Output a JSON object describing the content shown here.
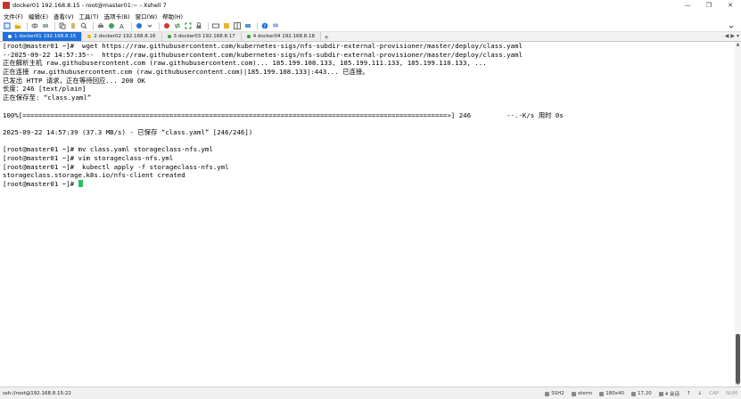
{
  "window": {
    "title": "docker01 192.168.8.15 - root@master01:~ - Xshell 7",
    "minimize_glyph": "—",
    "maximize_glyph": "❐",
    "close_glyph": "✕"
  },
  "menu": [
    "文件(F)",
    "编辑(E)",
    "查看(V)",
    "工具(T)",
    "选项卡(B)",
    "窗口(W)",
    "帮助(H)"
  ],
  "tabs": [
    {
      "label": "1 docker01 192.168.8.15",
      "active": true,
      "color": "#1e6fd9"
    },
    {
      "label": "2 docker02 192.168.8.16",
      "active": false,
      "color": "#f2b600"
    },
    {
      "label": "3 docker03 192.168.8.17",
      "active": false,
      "color": "#2ca02c"
    },
    {
      "label": "4 docker04 192.168.8.18",
      "active": false,
      "color": "#2ca02c"
    }
  ],
  "tab_add": "+",
  "tab_nav": {
    "prev": "◀",
    "next": "▶",
    "list": "▾"
  },
  "terminal_lines": [
    "[root@master01 ~]#  wget https://raw.githubusercontent.com/kubernetes-sigs/nfs-subdir-external-provisioner/master/deploy/class.yaml",
    "--2025-09-22 14:57:35--  https://raw.githubusercontent.com/kubernetes-sigs/nfs-subdir-external-provisioner/master/deploy/class.yaml",
    "正在解析主机 raw.githubusercontent.com (raw.githubusercontent.com)... 185.199.108.133, 185.199.111.133, 185.199.110.133, ...",
    "正在连接 raw.githubusercontent.com (raw.githubusercontent.com)|185.199.108.133|:443... 已连接。",
    "已发出 HTTP 请求，正在等待回应... 200 OK",
    "长度：246 [text/plain]",
    "正在保存至: “class.yaml”",
    "",
    "100%[===========================================================================================================>] 246         --.-K/s 用时 0s",
    "",
    "2025-09-22 14:57:39 (37.3 MB/s) - 已保存 “class.yaml” [246/246])",
    "",
    "[root@master01 ~]# mv class.yaml storageclass-nfs.yml",
    "[root@master01 ~]# vim storageclass-nfs.yml",
    "[root@master01 ~]#  kubectl apply -f storageclass-nfs.yml",
    "storageclass.storage.k8s.io/nfs-client created"
  ],
  "prompt": "[root@master01 ~]# ",
  "status": {
    "connection": "ssh://root@192.168.8.15:22",
    "protocol": "SSH2",
    "terminal": "xterm",
    "size": "180x40",
    "cursor_pos": "17,20",
    "sessions": "4 会话",
    "cap": "CAP",
    "num": "NUM"
  },
  "colors": {
    "accent": "#1e6fd9",
    "cursor": "#22c55e"
  }
}
